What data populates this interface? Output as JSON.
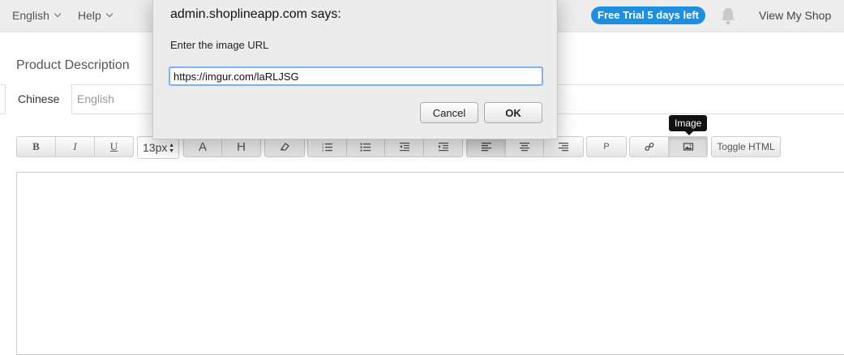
{
  "topbar": {
    "language": "English",
    "help": "Help",
    "trial_badge": "Free Trial 5 days left",
    "view_shop": "View My Shop"
  },
  "section": {
    "title": "Product Description"
  },
  "tabs": [
    {
      "label": "Chinese",
      "active": true
    },
    {
      "label": "English",
      "active": false
    }
  ],
  "toolbar": {
    "bold": "B",
    "italic": "I",
    "underline": "U",
    "font_size": "13px",
    "text_color": "A",
    "highlight": "H",
    "paragraph": "P",
    "toggle_html": "Toggle HTML",
    "tooltip": "Image"
  },
  "dialog": {
    "title": "admin.shoplineapp.com says:",
    "message": "Enter the image URL",
    "input_value": "https://imgur.com/laRLJSG",
    "cancel_label": "Cancel",
    "ok_label": "OK"
  },
  "colors": {
    "accent": "#1d8fe1",
    "topbar_bg": "#ededed"
  }
}
